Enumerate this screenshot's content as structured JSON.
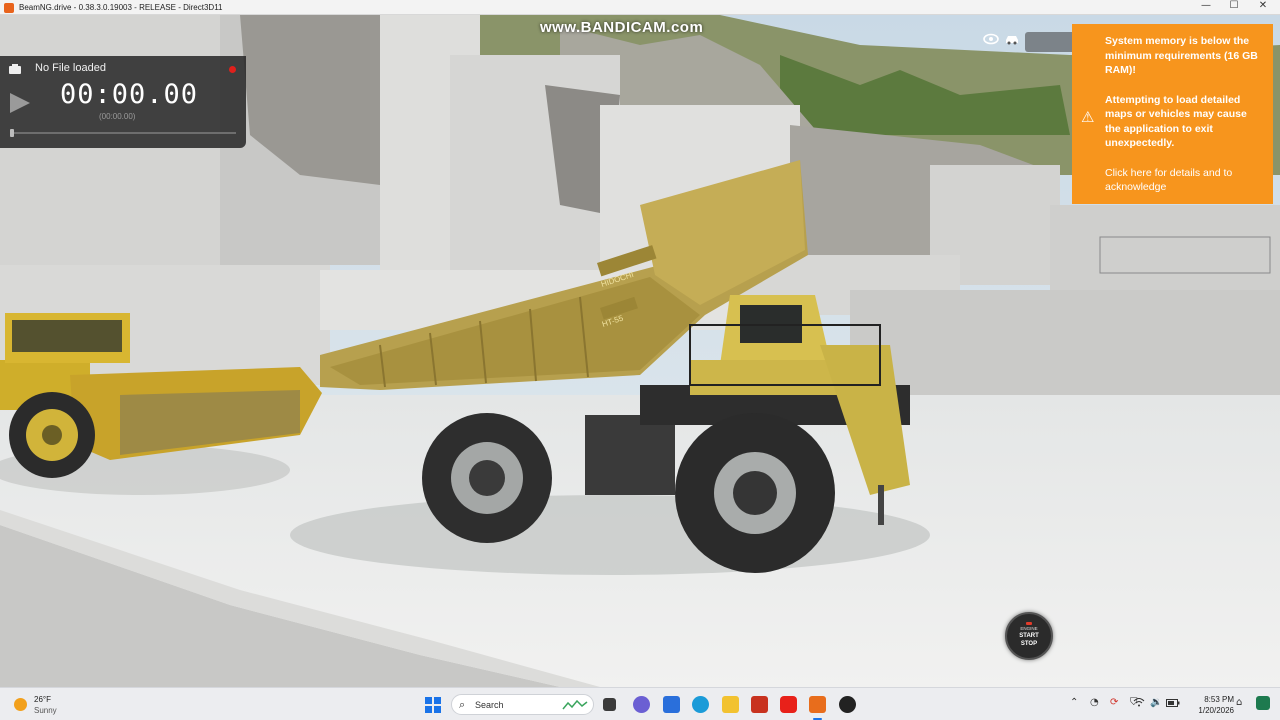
{
  "window": {
    "title": "BeamNG.drive - 0.38.3.0.19003 - RELEASE - Direct3D11",
    "minimize": "—",
    "maximize": "☐",
    "close": "✕"
  },
  "overlay": {
    "watermark": "www.BANDICAM.com"
  },
  "replay": {
    "file_label": "No File loaded",
    "time": "00:00.00",
    "time_sub": "(00:00.00)",
    "progress": 0
  },
  "warning": {
    "line1": "System memory is below the minimum requirements (16 GB RAM)!",
    "line2": "Attempting to load detailed maps or vehicles may cause the application to exit unexpectedly.",
    "line3": "Click here for details and to acknowledge",
    "color": "#f7951d"
  },
  "engine_button": {
    "top": "ENGINE",
    "mid": "START",
    "bottom": "STOP"
  },
  "scene": {
    "truck_brand": "HIDOCHI",
    "truck_model": "HT-55"
  },
  "taskbar": {
    "weather_temp": "26°F",
    "weather_desc": "Sunny",
    "search_placeholder": "Search",
    "time": "8:53 PM",
    "date": "1/20/2026"
  },
  "icons": [
    "camera-icon",
    "eye-icon",
    "car-icon",
    "warning-icon",
    "windows-start-icon",
    "search-icon"
  ]
}
